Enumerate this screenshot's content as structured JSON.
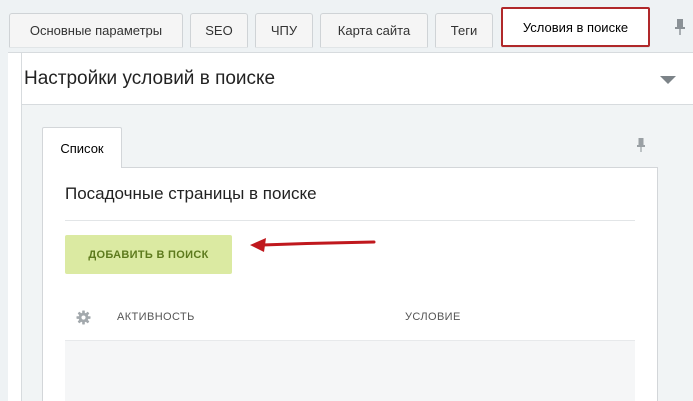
{
  "tabs": [
    {
      "label": "Основные параметры"
    },
    {
      "label": "SEO"
    },
    {
      "label": "ЧПУ"
    },
    {
      "label": "Карта сайта"
    },
    {
      "label": "Теги"
    },
    {
      "label": "Условия в поиске",
      "active": true
    }
  ],
  "panel": {
    "title": "Настройки условий в поиске"
  },
  "subtabs": [
    {
      "label": "Список",
      "active": true
    }
  ],
  "content": {
    "title": "Посадочные страницы в поиске",
    "add_button_label": "ДОБАВИТЬ В ПОИСК"
  },
  "grid": {
    "columns": [
      "АКТИВНОСТЬ",
      "УСЛОВИЕ"
    ]
  },
  "colors": {
    "accent_border": "#b0282a",
    "button_bg": "#dbeaa2",
    "button_text": "#5d7a1d",
    "annotation_arrow": "#c0181d"
  },
  "icons": {
    "pin": "pin-icon",
    "collapse": "chevron-down-icon",
    "gear": "gear-icon"
  }
}
